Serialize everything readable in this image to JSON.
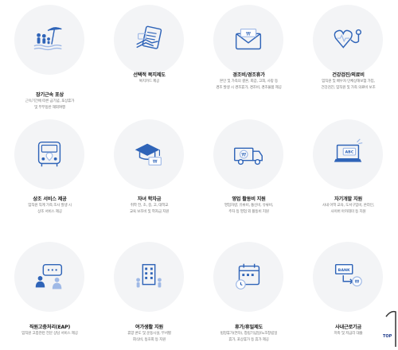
{
  "benefits": [
    {
      "title": "장기근속 포상",
      "desc": "근속기간에 따른 금기념, 포상휴가\n및 부부동반 해외여행",
      "icon": "beach-umbrella-family-icon"
    },
    {
      "title": "선택적 복지제도",
      "desc": "복지카드 제공",
      "icon": "card-document-icon"
    },
    {
      "title": "경조비/경조휴가",
      "desc": "본인 및 가족의 결혼, 회갑, 고희, 사망 등\n경조 발생 시 경조휴가, 경조비, 경조물품 제공",
      "icon": "envelope-money-icon"
    },
    {
      "title": "건강검진/의료비",
      "desc": "임직원 및 배우자 단체상해보험 가입,\n건강검진, 임직원 및 가족 의료비 보조",
      "icon": "heart-stethoscope-icon"
    },
    {
      "title": "상조 서비스 제공",
      "desc": "임직원 직계 가족 조사 발생 시\n상조 서비스 제공",
      "icon": "bus-location-icon"
    },
    {
      "title": "자녀 학자금",
      "desc": "취학 전, 초, 중, 고, 대학교\n교육 보조비 및 학자금 지원",
      "icon": "graduation-cap-money-icon"
    },
    {
      "title": "영업 활동비 지원",
      "desc": "영업차량, 유류비, 통신비, 유류비,\n주차 등 영업 외 활동비 지원",
      "icon": "delivery-truck-icon"
    },
    {
      "title": "자기개발 지원",
      "desc": "사내 어학 교육, 도서구입비, 온라인,\n사이버 아카데미 등 지원",
      "icon": "laptop-abc-icon"
    },
    {
      "title": "직원고충처리(EAP)",
      "desc": "임직원 고충관련 전문 상담 서비스 제공",
      "icon": "chat-bubbles-icon"
    },
    {
      "title": "여가생활 지원",
      "desc": "휴양 콘도 및 운동시설, 부서별\n회식비, 동호회 등 지원",
      "icon": "building-people-icon"
    },
    {
      "title": "휴가/휴일제도",
      "desc": "법정휴가(연차), 창립기념일/노조창립일\n휴가, 포상휴가 등 휴가 제공",
      "icon": "calendar-clock-icon"
    },
    {
      "title": "사내근로기금",
      "desc": "저축 및 저금리 대출",
      "icon": "bank-coins-icon"
    }
  ],
  "top_button": {
    "label": "TOP"
  },
  "colors": {
    "accent": "#2f64b8",
    "accent_light": "#9fb9e6",
    "circle": "#f3f4f6"
  }
}
